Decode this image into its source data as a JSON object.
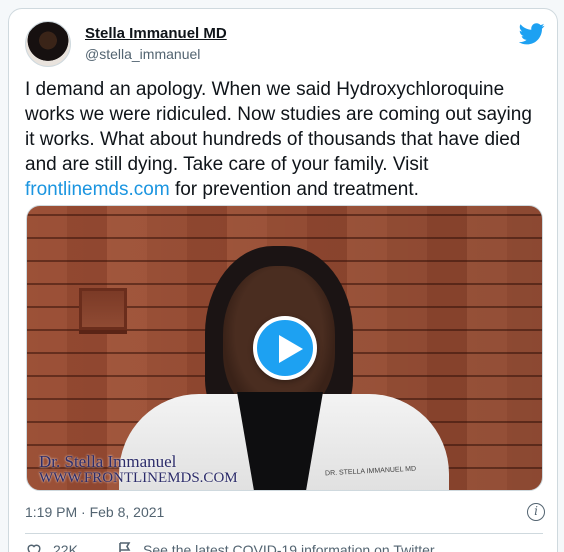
{
  "author": {
    "name": "Stella Immanuel MD",
    "handle": "@stella_immanuel"
  },
  "tweet": {
    "text_before_link": "I demand an apology. When we said Hydroxychloroquine works we were ridiculed. Now studies are coming out saying it works. What about hundreds of thousands that have died and are still dying. Take care of your family. Visit ",
    "link_text": "frontlinemds.com",
    "text_after_link": " for prevention and treatment."
  },
  "media": {
    "caption_name": "Dr. Stella Immanuel",
    "caption_site": "WWW.FRONTLINEMDS.COM",
    "coat_tag": "DR. STELLA IMMANUEL MD",
    "play_icon": "play-icon"
  },
  "timestamp": "1:19 PM · Feb 8, 2021",
  "actions": {
    "like_count": "22K",
    "covid_info": "See the latest COVID-19 information on Twitter"
  },
  "icons": {
    "brand": "twitter-bird-icon",
    "info": "info-icon",
    "like": "heart-icon",
    "covid": "covid-info-icon"
  },
  "colors": {
    "brand_blue": "#1da1f2",
    "link_blue": "#1b95e0",
    "muted_text": "#536471",
    "border": "#cfd9de"
  }
}
